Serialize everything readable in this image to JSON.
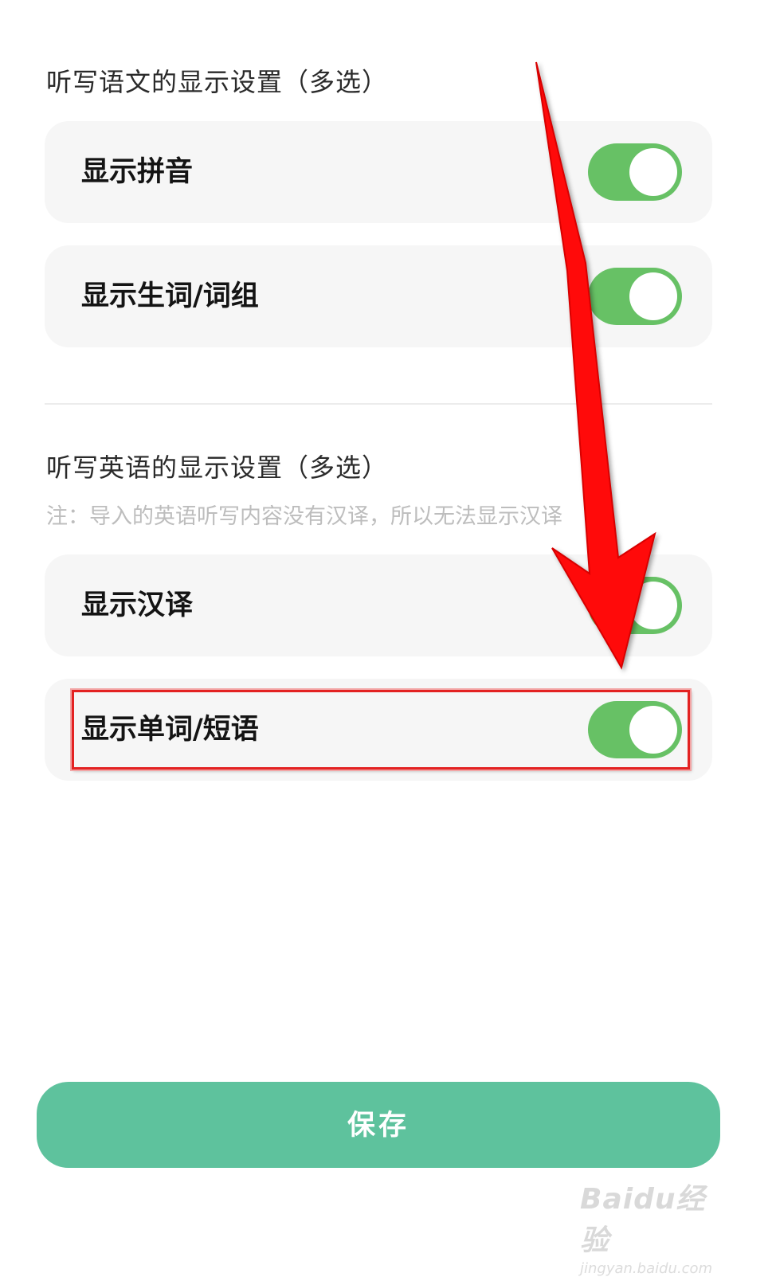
{
  "chinese_section": {
    "title": "听写语文的显示设置（多选）",
    "items": [
      {
        "label": "显示拼音",
        "enabled": true
      },
      {
        "label": "显示生词/词组",
        "enabled": true
      }
    ]
  },
  "english_section": {
    "title": "听写英语的显示设置（多选）",
    "note": "注：导入的英语听写内容没有汉译，所以无法显示汉译",
    "items": [
      {
        "label": "显示汉译",
        "enabled": true
      },
      {
        "label": "显示单词/短语",
        "enabled": true
      }
    ]
  },
  "footer": {
    "save_label": "保存"
  },
  "watermark": {
    "main": "Baidu经验",
    "sub": "jingyan.baidu.com"
  },
  "colors": {
    "toggle_on": "#67c165",
    "save_button": "#5ec29d",
    "annotation_red": "#e32222"
  }
}
